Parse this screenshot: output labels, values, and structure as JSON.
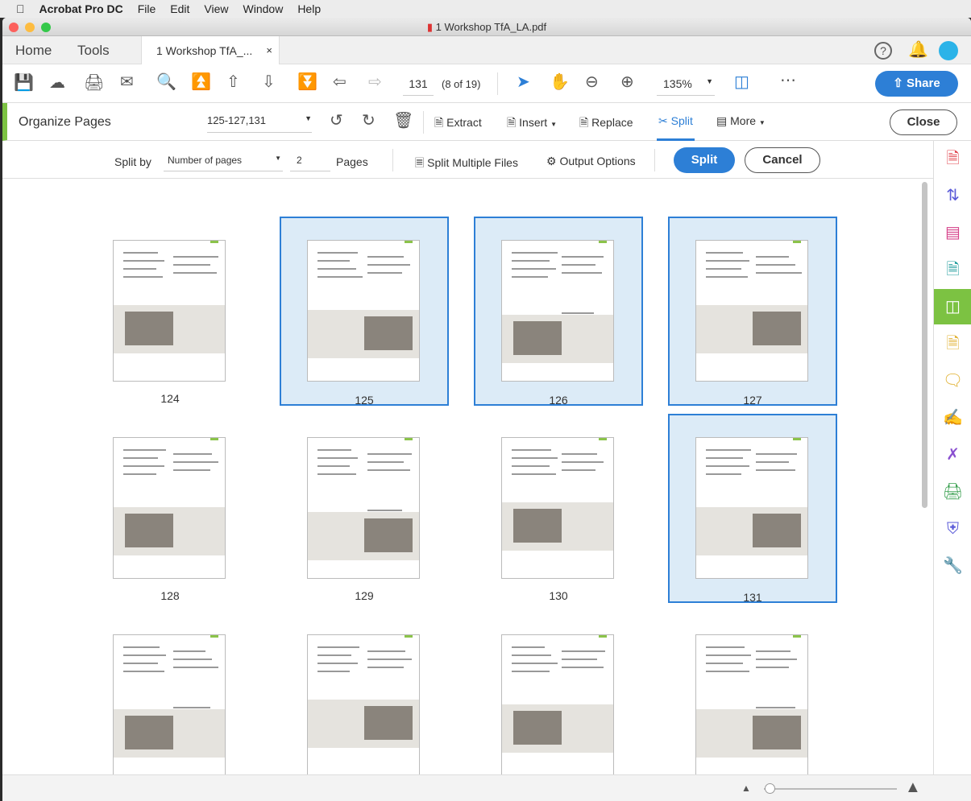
{
  "menubar": {
    "app": "Acrobat Pro DC",
    "items": [
      "File",
      "Edit",
      "View",
      "Window",
      "Help"
    ]
  },
  "window": {
    "title": "1 Workshop TfA_LA.pdf"
  },
  "tabs": {
    "home": "Home",
    "tools": "Tools",
    "document": "1 Workshop TfA_...",
    "close": "×"
  },
  "toolbar": {
    "page_number": "131",
    "page_of": "(8 of 19)",
    "zoom": "135%",
    "share": "Share"
  },
  "organize": {
    "title": "Organize Pages",
    "page_range": "125-127,131",
    "extract": "Extract",
    "insert": "Insert",
    "replace": "Replace",
    "split": "Split",
    "more": "More",
    "close": "Close"
  },
  "split_bar": {
    "split_by_label": "Split by",
    "split_by_value": "Number of pages",
    "pages_value": "2",
    "pages_label": "Pages",
    "split_multiple": "Split Multiple Files",
    "output_options": "Output Options",
    "split_button": "Split",
    "cancel_button": "Cancel"
  },
  "thumbnails": [
    {
      "page": "124",
      "selected": false
    },
    {
      "page": "125",
      "selected": true
    },
    {
      "page": "126",
      "selected": true
    },
    {
      "page": "127",
      "selected": true
    },
    {
      "page": "128",
      "selected": false
    },
    {
      "page": "129",
      "selected": false
    },
    {
      "page": "130",
      "selected": false
    },
    {
      "page": "131",
      "selected": true
    },
    {
      "page": "",
      "selected": false
    },
    {
      "page": "",
      "selected": false
    },
    {
      "page": "",
      "selected": false
    },
    {
      "page": "",
      "selected": false
    }
  ],
  "colors": {
    "accent": "#2d7fd6",
    "organize_green": "#7cc242",
    "selection_fill": "#dcebf7"
  }
}
